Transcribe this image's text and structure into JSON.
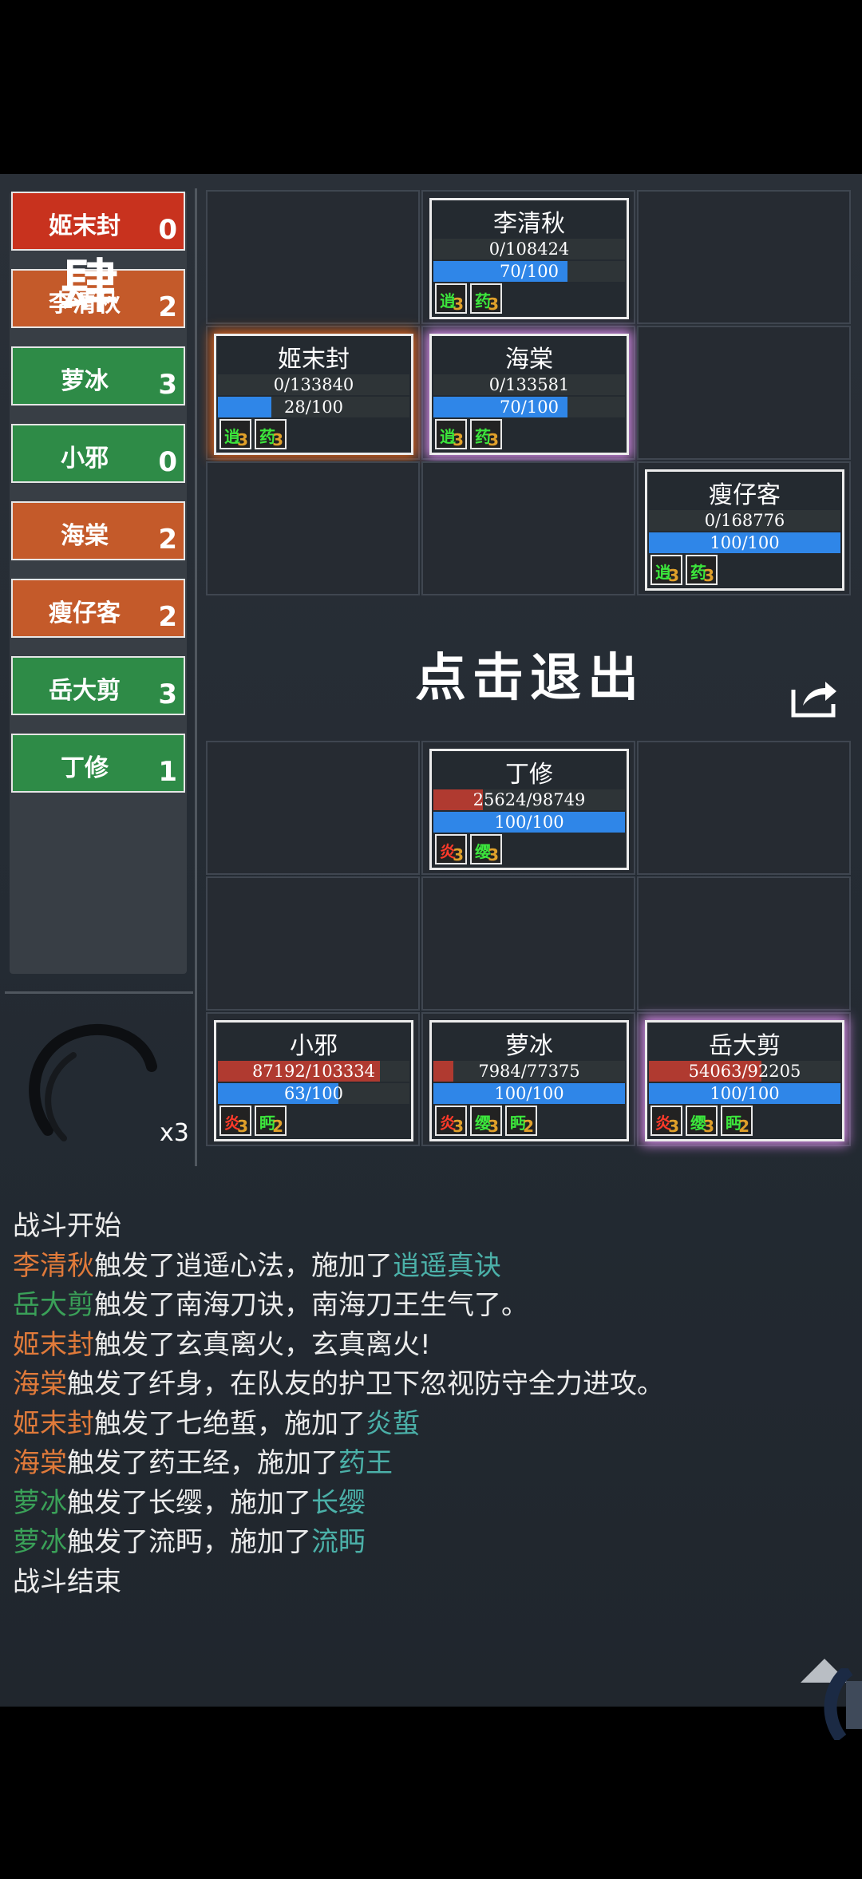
{
  "turn_order": [
    {
      "name": "姬末封",
      "count": "0",
      "color": "red"
    },
    {
      "name": "李清秋",
      "count": "2",
      "color": "orange"
    },
    {
      "name": "萝冰",
      "count": "3",
      "color": "green"
    },
    {
      "name": "小邪",
      "count": "0",
      "color": "green"
    },
    {
      "name": "海棠",
      "count": "2",
      "color": "orange"
    },
    {
      "name": "瘦仔客",
      "count": "2",
      "color": "orange"
    },
    {
      "name": "岳大剪",
      "count": "3",
      "color": "green"
    },
    {
      "name": "丁修",
      "count": "1",
      "color": "green"
    }
  ],
  "enemies": [
    {
      "name": "李清秋",
      "hp": "0/108424",
      "hp_frac": 0,
      "energy": "70/100",
      "en_frac": 0.7,
      "glow": "none",
      "buffs": [
        {
          "glyph": "逍",
          "count": "3",
          "color": "green"
        },
        {
          "glyph": "药",
          "count": "3",
          "color": "green"
        }
      ]
    },
    {
      "name": "姬末封",
      "hp": "0/133840",
      "hp_frac": 0,
      "energy": "28/100",
      "en_frac": 0.28,
      "glow": "orange",
      "buffs": [
        {
          "glyph": "逍",
          "count": "3",
          "color": "green"
        },
        {
          "glyph": "药",
          "count": "3",
          "color": "green"
        }
      ]
    },
    {
      "name": "海棠",
      "hp": "0/133581",
      "hp_frac": 0,
      "energy": "70/100",
      "en_frac": 0.7,
      "glow": "purple",
      "buffs": [
        {
          "glyph": "逍",
          "count": "3",
          "color": "green"
        },
        {
          "glyph": "药",
          "count": "3",
          "color": "green"
        }
      ]
    },
    {
      "name": "瘦仔客",
      "hp": "0/168776",
      "hp_frac": 0,
      "energy": "100/100",
      "en_frac": 1,
      "glow": "none",
      "buffs": [
        {
          "glyph": "逍",
          "count": "3",
          "color": "green"
        },
        {
          "glyph": "药",
          "count": "3",
          "color": "green"
        }
      ]
    }
  ],
  "allies": [
    {
      "name": "丁修",
      "hp": "25624/98749",
      "hp_frac": 0.26,
      "energy": "100/100",
      "en_frac": 1,
      "glow": "none",
      "buffs": [
        {
          "glyph": "炎",
          "count": "3",
          "color": "red"
        },
        {
          "glyph": "缨",
          "count": "3",
          "color": "green"
        }
      ]
    },
    {
      "name": "小邪",
      "hp": "87192/103334",
      "hp_frac": 0.844,
      "energy": "63/100",
      "en_frac": 0.63,
      "glow": "none",
      "buffs": [
        {
          "glyph": "炎",
          "count": "3",
          "color": "red"
        },
        {
          "glyph": "眄",
          "count": "2",
          "color": "green"
        }
      ]
    },
    {
      "name": "萝冰",
      "hp": "7984/77375",
      "hp_frac": 0.103,
      "energy": "100/100",
      "en_frac": 1,
      "glow": "none",
      "buffs": [
        {
          "glyph": "炎",
          "count": "3",
          "color": "red"
        },
        {
          "glyph": "缨",
          "count": "3",
          "color": "green"
        },
        {
          "glyph": "眄",
          "count": "2",
          "color": "green"
        }
      ]
    },
    {
      "name": "岳大剪",
      "hp": "54063/92205",
      "hp_frac": 0.586,
      "energy": "100/100",
      "en_frac": 1,
      "glow": "purple",
      "buffs": [
        {
          "glyph": "炎",
          "count": "3",
          "color": "red"
        },
        {
          "glyph": "缨",
          "count": "3",
          "color": "green"
        },
        {
          "glyph": "眄",
          "count": "2",
          "color": "green"
        }
      ]
    }
  ],
  "exit_label": "点击退出",
  "speed": {
    "char": "肆",
    "multiplier": "x3"
  },
  "log": [
    [
      {
        "t": "战斗开始",
        "c": "plain"
      }
    ],
    [
      {
        "t": "李清秋",
        "c": "orange"
      },
      {
        "t": "触发了逍遥心法，施加了",
        "c": "plain"
      },
      {
        "t": "逍遥真诀",
        "c": "teal"
      }
    ],
    [
      {
        "t": "岳大剪",
        "c": "green"
      },
      {
        "t": "触发了南海刀诀，南海刀王生气了。",
        "c": "plain"
      }
    ],
    [
      {
        "t": "姬末封",
        "c": "orange"
      },
      {
        "t": "触发了玄真离火，玄真离火!",
        "c": "plain"
      }
    ],
    [
      {
        "t": "海棠",
        "c": "orange"
      },
      {
        "t": "触发了纤身，在队友的护卫下忽视防守全力进攻。",
        "c": "plain"
      }
    ],
    [
      {
        "t": "姬末封",
        "c": "orange"
      },
      {
        "t": "触发了七绝蜇，施加了",
        "c": "plain"
      },
      {
        "t": "炎蜇",
        "c": "teal"
      }
    ],
    [
      {
        "t": "海棠",
        "c": "orange"
      },
      {
        "t": "触发了药王经，施加了",
        "c": "plain"
      },
      {
        "t": "药王",
        "c": "teal"
      }
    ],
    [
      {
        "t": "萝冰",
        "c": "green"
      },
      {
        "t": "触发了长缨，施加了",
        "c": "plain"
      },
      {
        "t": "长缨",
        "c": "teal"
      }
    ],
    [
      {
        "t": "萝冰",
        "c": "green"
      },
      {
        "t": "触发了流眄，施加了",
        "c": "plain"
      },
      {
        "t": "流眄",
        "c": "teal"
      }
    ],
    [
      {
        "t": "战斗结束",
        "c": "plain"
      }
    ]
  ]
}
